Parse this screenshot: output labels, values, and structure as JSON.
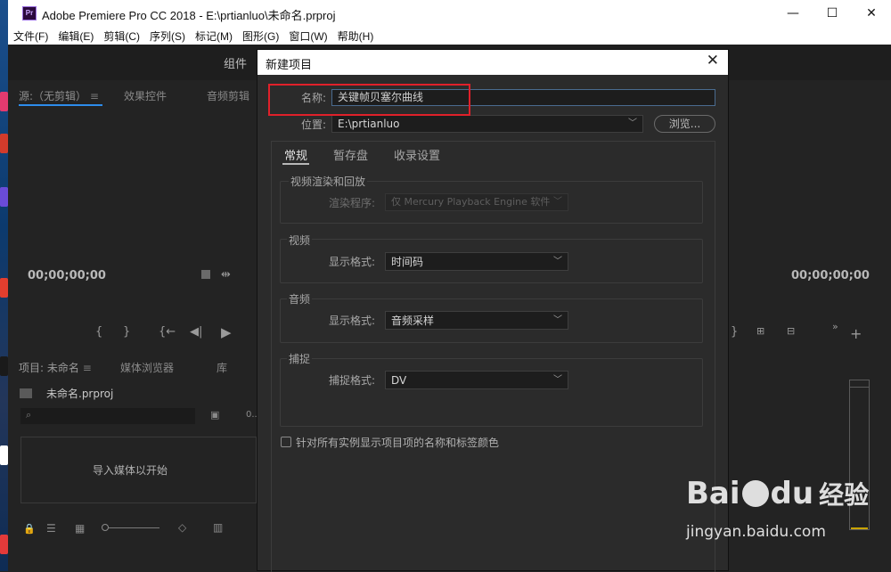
{
  "window": {
    "title": "Adobe Premiere Pro CC 2018 - E:\\prtianluo\\未命名.prproj",
    "app_icon": "Pr",
    "minimize": "—",
    "maximize": "☐",
    "close": "✕"
  },
  "menubar": [
    "文件(F)",
    "编辑(E)",
    "剪辑(C)",
    "序列(S)",
    "标记(M)",
    "图形(G)",
    "窗口(W)",
    "帮助(H)"
  ],
  "workspace": {
    "tab": "组件"
  },
  "source_panel": {
    "tabs": [
      "源:（无剪辑）",
      "效果控件",
      "音频剪辑"
    ],
    "timecode": "00;00;00;00"
  },
  "program_panel": {
    "timecode": "00;00;00;00"
  },
  "project_panel": {
    "tabs": [
      "项目: 未命名",
      "媒体浏览器",
      "库"
    ],
    "file": "未命名.prproj",
    "search_count": "0...",
    "empty_hint": "导入媒体以开始"
  },
  "dialog": {
    "title": "新建项目",
    "close": "✕",
    "name_label": "名称:",
    "name_value": "关键帧贝塞尔曲线",
    "location_label": "位置:",
    "location_value": "E:\\prtianluo",
    "browse": "浏览...",
    "tabs": [
      "常规",
      "暂存盘",
      "收录设置"
    ],
    "render_group": {
      "title": "视频渲染和回放",
      "label": "渲染程序:",
      "value": "仅 Mercury Playback Engine 软件"
    },
    "video_group": {
      "title": "视频",
      "label": "显示格式:",
      "value": "时间码"
    },
    "audio_group": {
      "title": "音频",
      "label": "显示格式:",
      "value": "音频采样"
    },
    "capture_group": {
      "title": "捕捉",
      "label": "捕捉格式:",
      "value": "DV"
    },
    "checkbox_label": "针对所有实例显示项目项的名称和标签颜色"
  },
  "watermark": {
    "brand": "Bai",
    "brand2": "du",
    "suffix": "经验",
    "url": "jingyan.baidu.com"
  },
  "colors": {
    "highlight": "#e0202a",
    "accent": "#2d8ceb"
  }
}
